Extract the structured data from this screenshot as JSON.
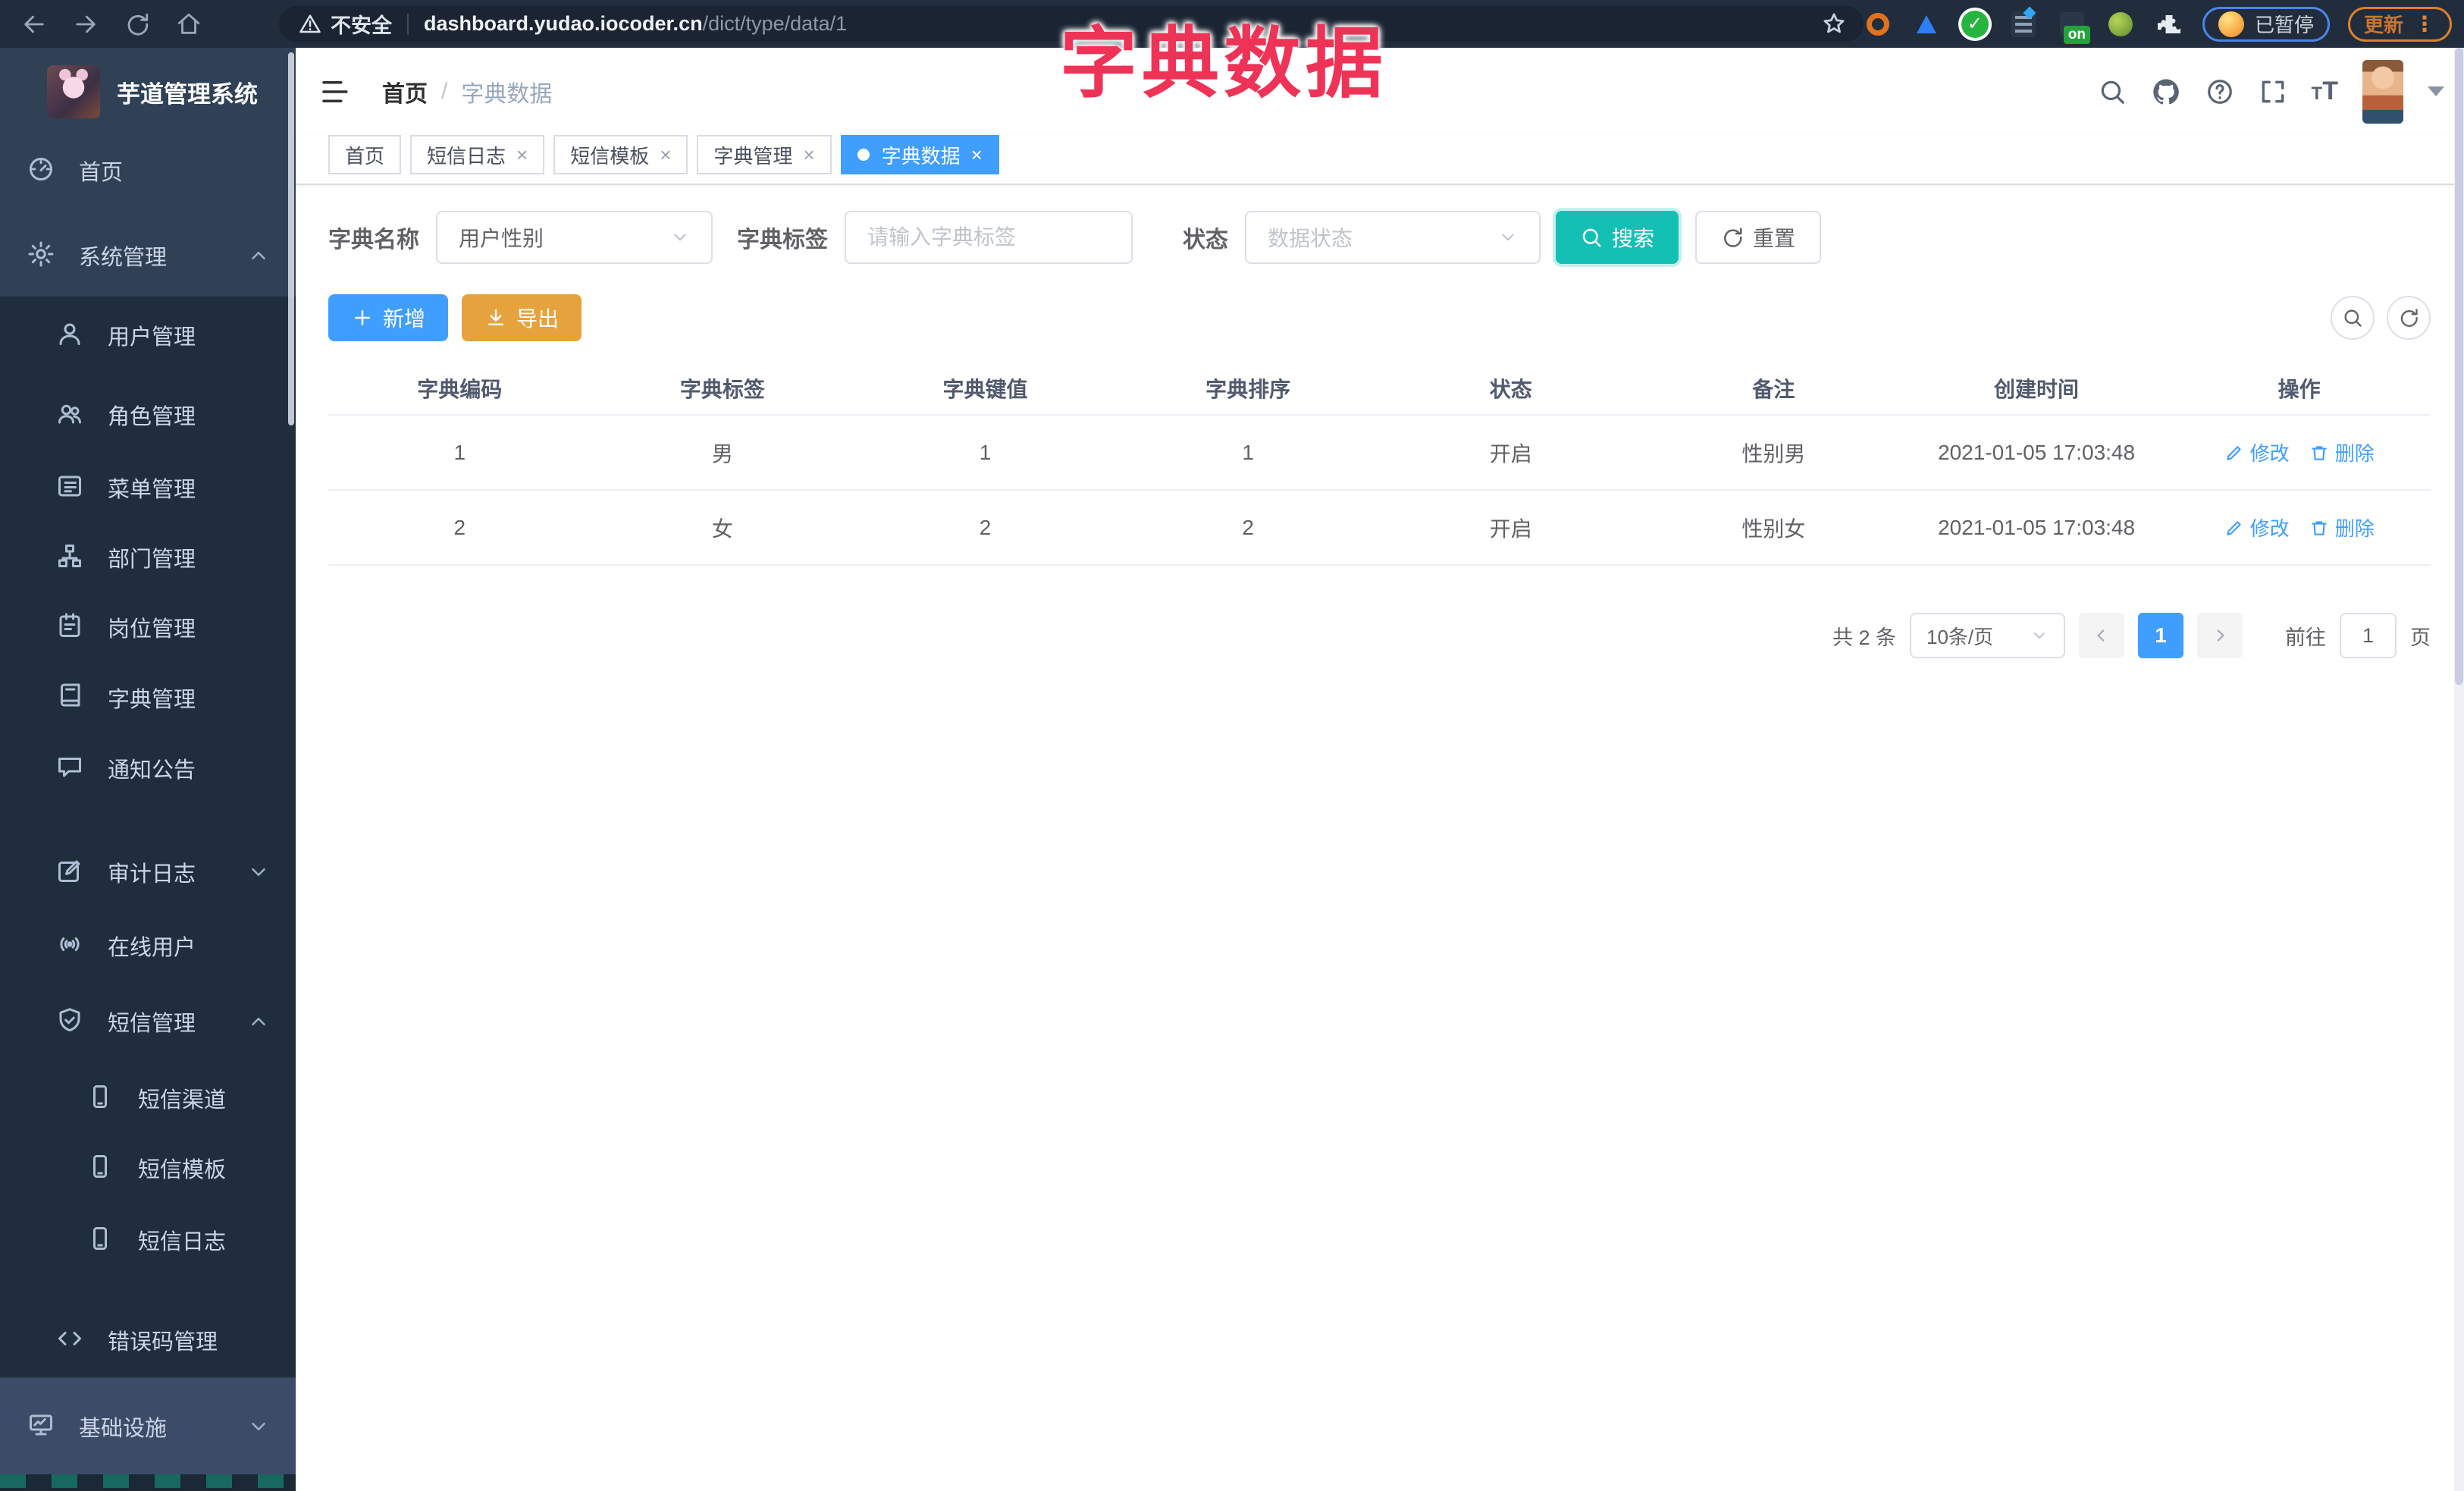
{
  "browser": {
    "security_label": "不安全",
    "url_host": "dashboard.yudao.iocoder.cn",
    "url_path": "/dict/type/data/1",
    "extension_on_badge": "on",
    "paused_badge": "已暂停",
    "update_badge": "更新"
  },
  "overlay_title": "字典数据",
  "sidebar": {
    "logo_title": "芋道管理系统",
    "items": [
      {
        "label": "首页"
      },
      {
        "label": "系统管理"
      },
      {
        "label": "用户管理"
      },
      {
        "label": "角色管理"
      },
      {
        "label": "菜单管理"
      },
      {
        "label": "部门管理"
      },
      {
        "label": "岗位管理"
      },
      {
        "label": "字典管理"
      },
      {
        "label": "通知公告"
      },
      {
        "label": "审计日志"
      },
      {
        "label": "在线用户"
      },
      {
        "label": "短信管理"
      },
      {
        "label": "短信渠道"
      },
      {
        "label": "短信模板"
      },
      {
        "label": "短信日志"
      },
      {
        "label": "错误码管理"
      },
      {
        "label": "基础设施"
      }
    ]
  },
  "header": {
    "breadcrumb_home": "首页",
    "breadcrumb_sep": "/",
    "breadcrumb_current": "字典数据",
    "fontsize_icon_text": "T"
  },
  "tabs": [
    {
      "label": "首页"
    },
    {
      "label": "短信日志"
    },
    {
      "label": "短信模板"
    },
    {
      "label": "字典管理"
    },
    {
      "label": "字典数据"
    }
  ],
  "filters": {
    "dict_name_label": "字典名称",
    "dict_name_value": "用户性别",
    "dict_label_label": "字典标签",
    "dict_label_placeholder": "请输入字典标签",
    "status_label": "状态",
    "status_placeholder": "数据状态",
    "search_label": "搜索",
    "reset_label": "重置"
  },
  "toolbar": {
    "add_label": "新增",
    "export_label": "导出"
  },
  "table": {
    "columns": [
      "字典编码",
      "字典标签",
      "字典键值",
      "字典排序",
      "状态",
      "备注",
      "创建时间",
      "操作"
    ],
    "rows": [
      {
        "code": "1",
        "label": "男",
        "value": "1",
        "sort": "1",
        "status": "开启",
        "remark": "性别男",
        "created": "2021-01-05 17:03:48"
      },
      {
        "code": "2",
        "label": "女",
        "value": "2",
        "sort": "2",
        "status": "开启",
        "remark": "性别女",
        "created": "2021-01-05 17:03:48"
      }
    ],
    "edit_label": "修改",
    "delete_label": "删除"
  },
  "pagination": {
    "total_text": "共 2 条",
    "page_size_value": "10条/页",
    "current_page": "1",
    "goto_label": "前往",
    "goto_value": "1",
    "page_suffix": "页"
  },
  "colors": {
    "accent_blue": "#409eff",
    "search_teal": "#14bfb4",
    "export_orange": "#e6a23c",
    "annotation_pink": "#ee3357",
    "sidebar_bg": "#304156",
    "submenu_bg": "#1f2d3d",
    "browser_bar_bg": "#212c3c"
  }
}
